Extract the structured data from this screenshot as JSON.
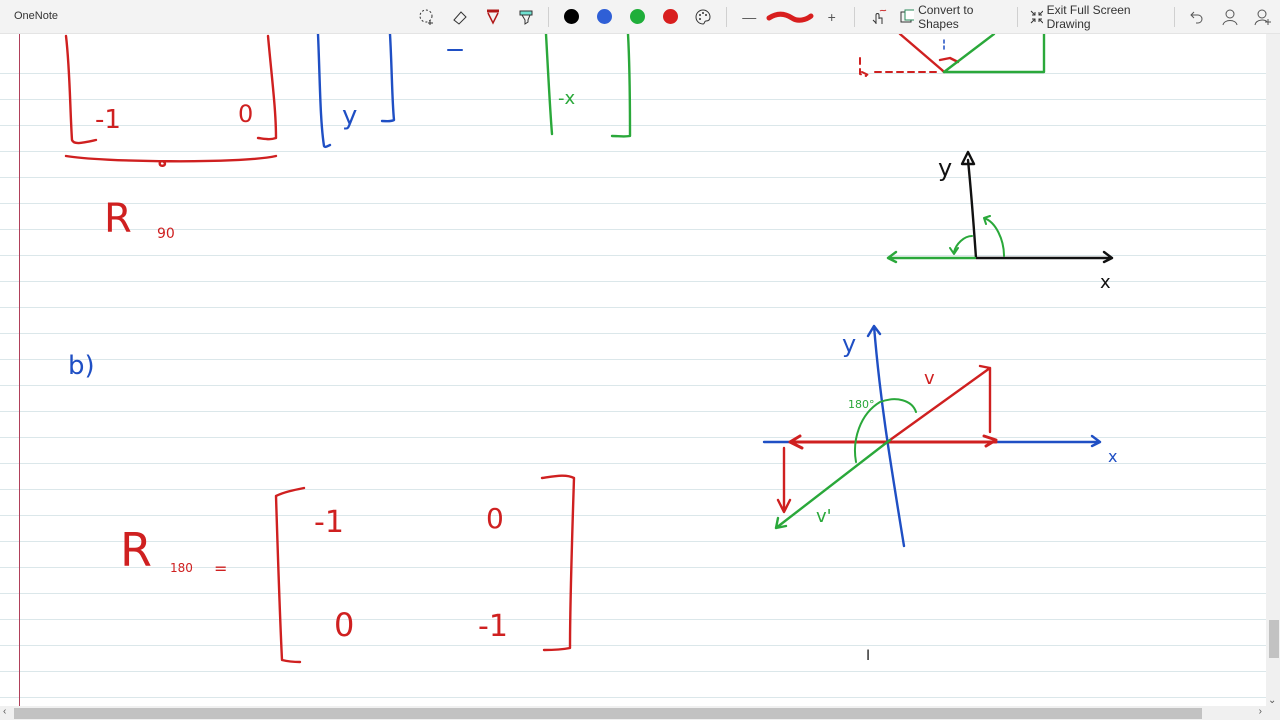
{
  "app": {
    "title": "OneNote"
  },
  "toolbar": {
    "tools": [
      {
        "name": "lasso-select",
        "label": "Lasso Select"
      },
      {
        "name": "eraser",
        "label": "Eraser"
      },
      {
        "name": "pen",
        "label": "Pen"
      },
      {
        "name": "highlighter",
        "label": "Highlighter"
      }
    ],
    "colors": [
      {
        "name": "black",
        "hex": "#000000"
      },
      {
        "name": "blue",
        "hex": "#2f5fd6"
      },
      {
        "name": "green",
        "hex": "#1fae3a"
      },
      {
        "name": "red",
        "hex": "#d81e1e"
      }
    ],
    "thickness_decrease": "—",
    "thickness_increase": "+",
    "convert_to_shapes": "Convert to Shapes",
    "exit_full_screen": "Exit Full Screen Drawing"
  },
  "ink": {
    "colors": {
      "red": "#cf2020",
      "blue": "#1f4fc4",
      "green": "#2aa83a",
      "black": "#111111"
    },
    "section_a": {
      "matrix_bottom_row": [
        "-1",
        "0"
      ],
      "vector_entry": "y",
      "equals": "=",
      "result_entry": "-x",
      "label": "R",
      "label_sub": "90"
    },
    "section_b": {
      "marker": "b)",
      "label": "R",
      "label_sub": "180",
      "equals": "=",
      "matrix": [
        [
          "-1",
          "0"
        ],
        [
          "0",
          "-1"
        ]
      ]
    },
    "diagram1": {
      "y_label": "y",
      "x_label": "x"
    },
    "diagram2": {
      "y_label": "y",
      "x_label": "x",
      "v_label": "v",
      "v_prime_label": "v'",
      "angle_label": "180°"
    }
  }
}
